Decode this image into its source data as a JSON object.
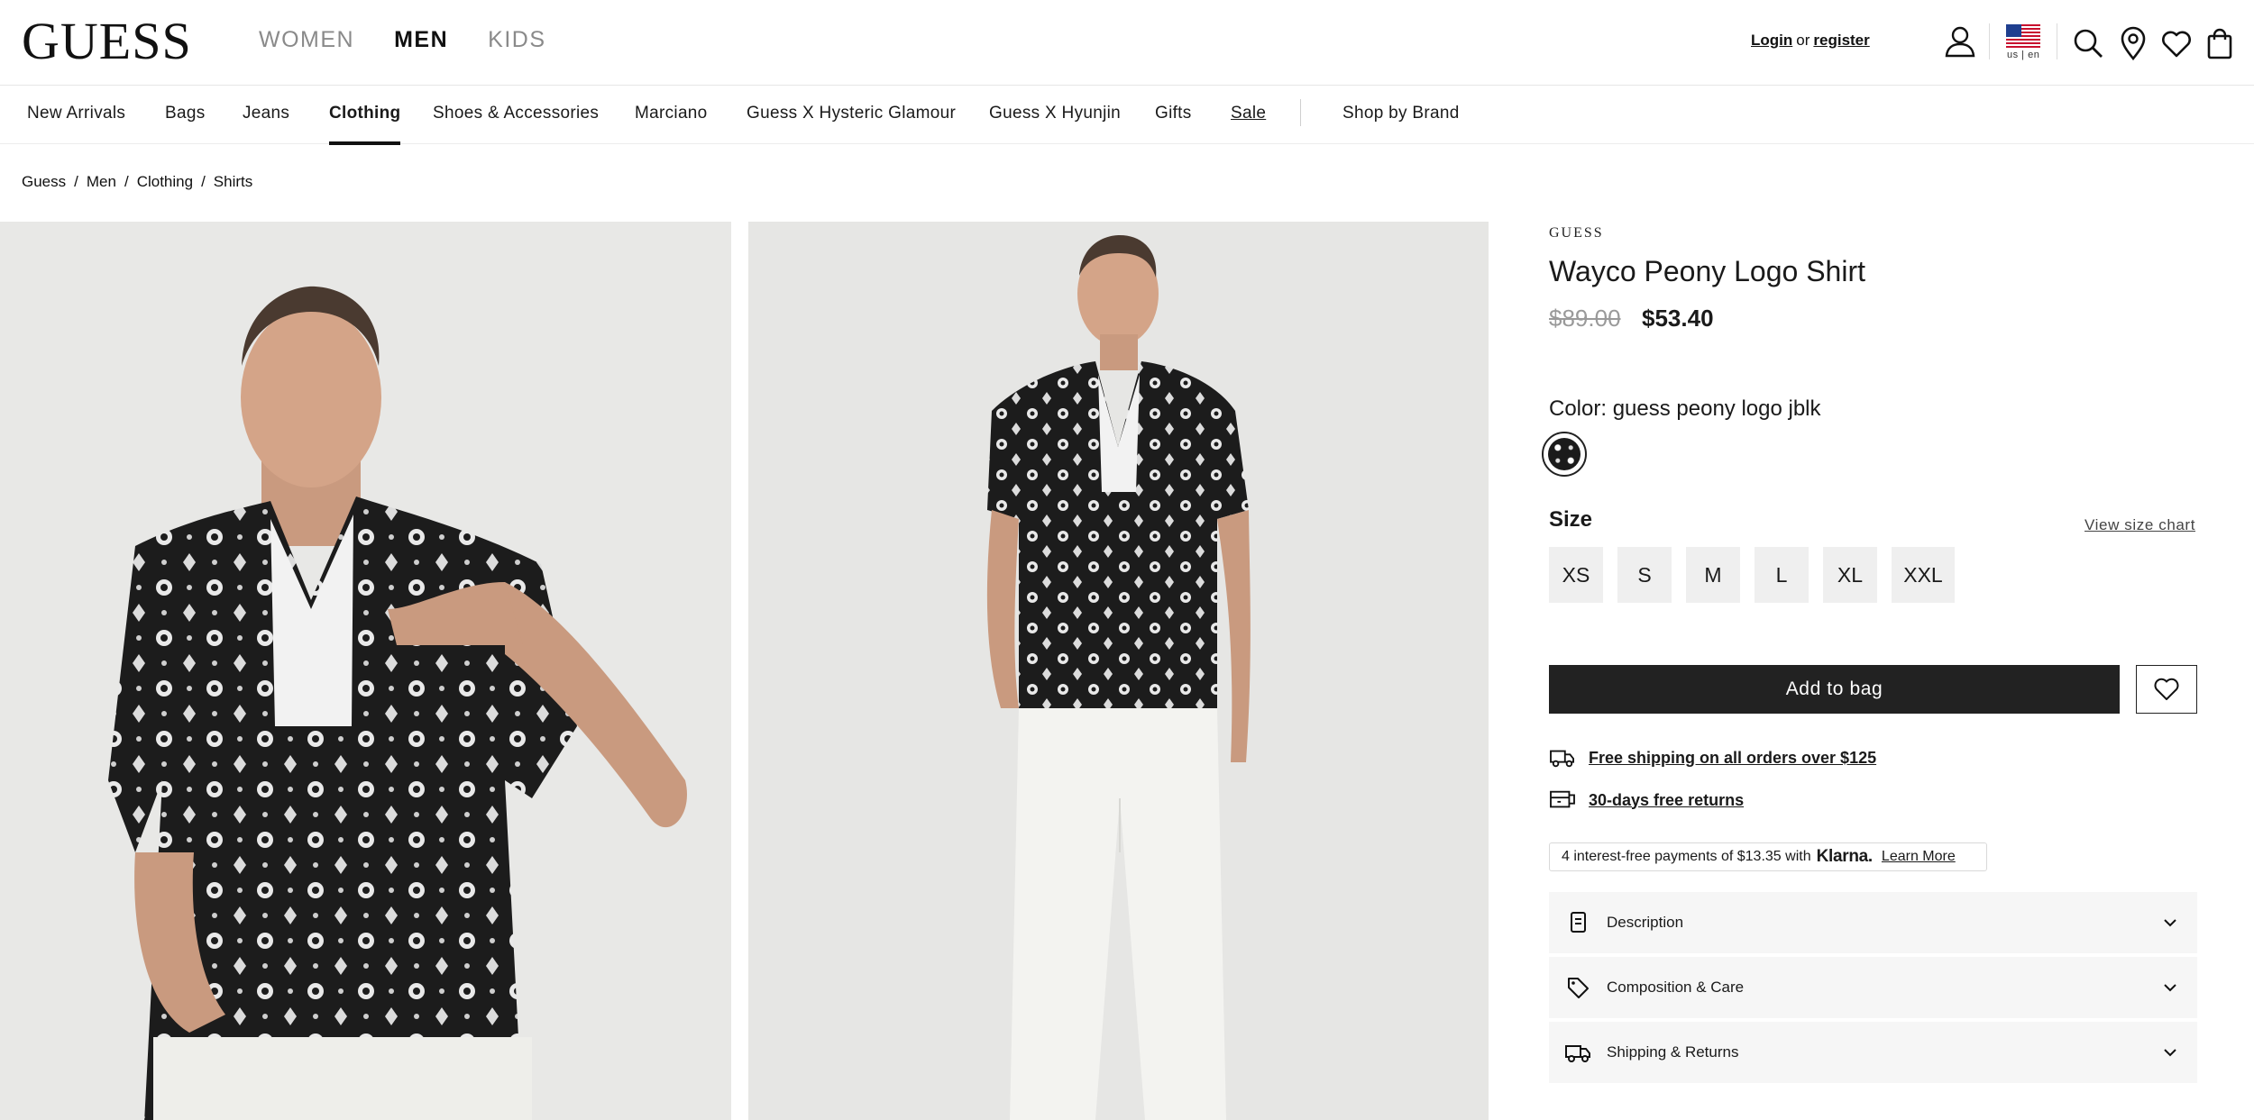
{
  "header": {
    "logo": "GUESS",
    "gender_tabs": [
      {
        "label": "WOMEN",
        "active": false
      },
      {
        "label": "MEN",
        "active": true
      },
      {
        "label": "KIDS",
        "active": false
      }
    ],
    "login_label": "Login",
    "or_label": "or",
    "register_label": "register",
    "locale_label": "us | en"
  },
  "category_nav": [
    {
      "label": "New Arrivals"
    },
    {
      "label": "Bags"
    },
    {
      "label": "Jeans"
    },
    {
      "label": "Clothing",
      "active": true
    },
    {
      "label": "Shoes & Accessories"
    },
    {
      "label": "Marciano"
    },
    {
      "label": "Guess X Hysteric Glamour"
    },
    {
      "label": "Guess X Hyunjin"
    },
    {
      "label": "Gifts"
    },
    {
      "label": "Sale"
    },
    {
      "label": "Shop by Brand"
    }
  ],
  "breadcrumb": [
    "Guess",
    "Men",
    "Clothing",
    "Shirts"
  ],
  "product": {
    "brand": "GUESS",
    "name": "Wayco Peony Logo Shirt",
    "price_original": "$89.00",
    "price_sale": "$53.40",
    "color_label": "Color: guess peony logo jblk",
    "size_label": "Size",
    "size_chart_label": "View size chart",
    "sizes": [
      "XS",
      "S",
      "M",
      "L",
      "XL",
      "XXL"
    ],
    "add_to_bag_label": "Add to bag"
  },
  "perks": {
    "shipping": "Free shipping on all orders over $125",
    "returns": "30-days free returns"
  },
  "klarna": {
    "prefix": "4 interest-free payments of $13.35 with",
    "brand": "Klarna.",
    "learn_more": "Learn More"
  },
  "accordions": [
    {
      "label": "Description",
      "icon": "document-icon"
    },
    {
      "label": "Composition & Care",
      "icon": "tag-icon"
    },
    {
      "label": "Shipping & Returns",
      "icon": "truck-icon"
    }
  ],
  "colors": {
    "text": "#1a1a1a",
    "button_bg": "#222222",
    "muted": "#8a8a8a",
    "panel_bg": "#f6f6f6",
    "image_bg": "#e9e9e7"
  }
}
